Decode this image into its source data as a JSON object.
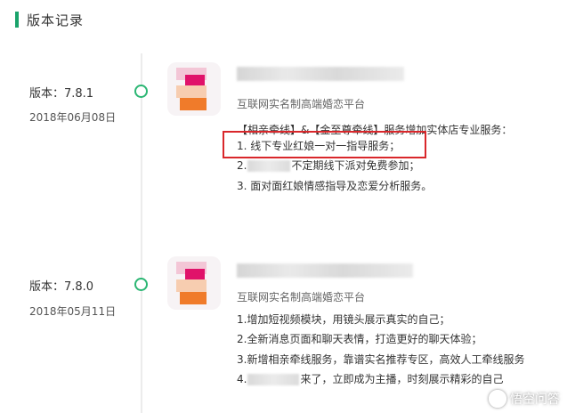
{
  "header": {
    "title": "版本记录"
  },
  "versions": [
    {
      "version": "版本：7.8.1",
      "date": "2018年06月08日",
      "subtitle": "互联网实名制高端婚恋平台",
      "lines": [
        "【相亲牵线】&【金至尊牵线】服务增加实体店专业服务：",
        "1. 线下专业红娘一对一指导服务；",
        "不定期线下派对免费参加；",
        "3. 面对面红娘情感指导及恋爱分析服务。"
      ],
      "line2_prefix": "2."
    },
    {
      "version": "版本：7.8.0",
      "date": "2018年05月11日",
      "subtitle": "互联网实名制高端婚恋平台",
      "lines": [
        "1.增加短视频模块，用镜头展示真实的自己；",
        "2.全新消息页面和聊天表情，打造更好的聊天体验；",
        "3.新增相亲牵线服务，靠谱实名推荐专区，高效人工牵线服务",
        "来了，立即成为主播，时刻展示精彩的自己"
      ],
      "line4_prefix": "4."
    }
  ],
  "watermark": {
    "text": "悟空问答"
  },
  "colors": {
    "accent": "#1aa36b",
    "highlight": "#d9272b"
  }
}
